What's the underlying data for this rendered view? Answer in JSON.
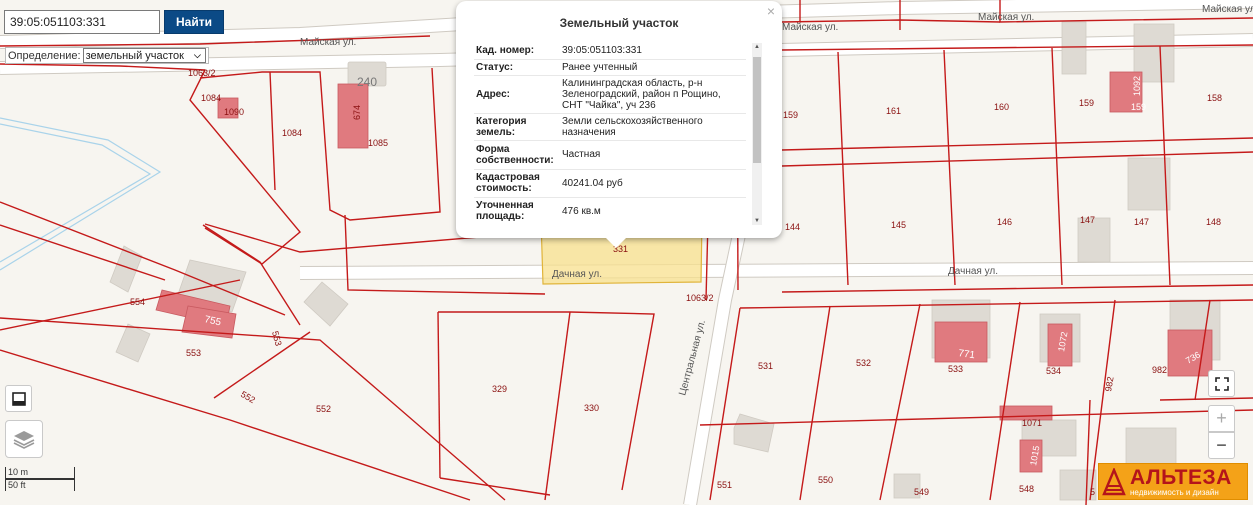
{
  "search": {
    "value": "39:05:051103:331",
    "button_label": "Найти"
  },
  "definition": {
    "label": "Определение:",
    "selected": "земельный участок"
  },
  "popup": {
    "title": "Земельный участок",
    "rows": [
      {
        "key": "Кад. номер:",
        "value": "39:05:051103:331"
      },
      {
        "key": "Статус:",
        "value": "Ранее учтенный"
      },
      {
        "key": "Адрес:",
        "value": "Калининградская область, р-н Зеленоградский, район п Рощино, СНТ \"Чайка\", уч 236"
      },
      {
        "key": "Категория земель:",
        "value": "Земли сельскохозяйственного назначения"
      },
      {
        "key": "Форма собственности:",
        "value": "Частная"
      },
      {
        "key": "Кадастровая стоимость:",
        "value": "40241.04 руб"
      },
      {
        "key": "Уточненная площадь:",
        "value": "476 кв.м"
      }
    ]
  },
  "map": {
    "streets": [
      "Майская ул.",
      "Майская ул.",
      "Майская ул.",
      "Майская ул.",
      "Дачная ул.",
      "Дачная ул.",
      "Центральная ул."
    ],
    "parcel_labels": [
      "1063/2",
      "1084",
      "1090",
      "1084",
      "1085",
      "240",
      "674",
      "159",
      "161",
      "160",
      "159",
      "158",
      "1092",
      "159",
      "144",
      "145",
      "146",
      "147",
      "147",
      "148",
      "331",
      "1063/2",
      "554",
      "755",
      "553",
      "553",
      "552",
      "552",
      "329",
      "330",
      "531",
      "532",
      "771",
      "533",
      "534",
      "1072",
      "982",
      "982",
      "736",
      "1071",
      "1015",
      "551",
      "550",
      "549",
      "548",
      "5"
    ],
    "selected_parcel": "331"
  },
  "scale": {
    "metric": "10 m",
    "imperial": "50 ft"
  },
  "logo": {
    "name": "АЛЬТЕЗА",
    "tagline": "недвижимость и дизайн"
  },
  "colors": {
    "parcel_border": "#c41a1a",
    "selected_fill": "#f8e08e",
    "search_button": "#0b4a86",
    "logo_bg": "#f4a218",
    "logo_text": "#b4141b"
  },
  "icons": {
    "close": "close-icon",
    "basemap": "basemap-icon",
    "layers": "layers-icon",
    "fullscreen": "fullscreen-icon"
  }
}
